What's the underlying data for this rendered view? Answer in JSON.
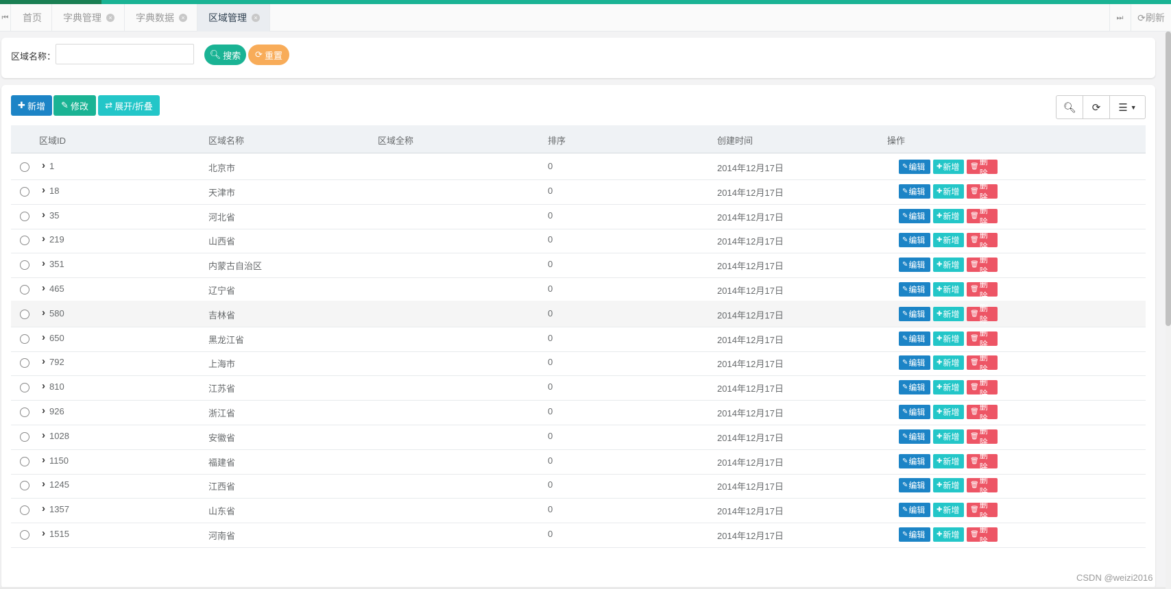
{
  "tabbar": {
    "tabs": [
      {
        "label": "首页",
        "closable": false
      },
      {
        "label": "字典管理",
        "closable": true
      },
      {
        "label": "字典数据",
        "closable": true
      },
      {
        "label": "区域管理",
        "closable": true,
        "active": true
      }
    ],
    "refresh_label": "刷新"
  },
  "search": {
    "label": "区域名称：",
    "input_value": "",
    "search_button": "搜索",
    "reset_button": "重置"
  },
  "toolbar": {
    "add_label": "新增",
    "edit_label": "修改",
    "toggle_label": "展开/折叠"
  },
  "table": {
    "columns": [
      "区域ID",
      "区域名称",
      "区域全称",
      "排序",
      "创建时间",
      "操作"
    ],
    "action_labels": {
      "edit": "编辑",
      "add": "新增",
      "delete": "删除"
    },
    "rows": [
      {
        "id": "1",
        "name": "北京市",
        "full": "",
        "sort": "0",
        "created": "2014年12月17日"
      },
      {
        "id": "18",
        "name": "天津市",
        "full": "",
        "sort": "0",
        "created": "2014年12月17日"
      },
      {
        "id": "35",
        "name": "河北省",
        "full": "",
        "sort": "0",
        "created": "2014年12月17日"
      },
      {
        "id": "219",
        "name": "山西省",
        "full": "",
        "sort": "0",
        "created": "2014年12月17日"
      },
      {
        "id": "351",
        "name": "内蒙古自治区",
        "full": "",
        "sort": "0",
        "created": "2014年12月17日"
      },
      {
        "id": "465",
        "name": "辽宁省",
        "full": "",
        "sort": "0",
        "created": "2014年12月17日"
      },
      {
        "id": "580",
        "name": "吉林省",
        "full": "",
        "sort": "0",
        "created": "2014年12月17日",
        "highlight": true
      },
      {
        "id": "650",
        "name": "黑龙江省",
        "full": "",
        "sort": "0",
        "created": "2014年12月17日"
      },
      {
        "id": "792",
        "name": "上海市",
        "full": "",
        "sort": "0",
        "created": "2014年12月17日"
      },
      {
        "id": "810",
        "name": "江苏省",
        "full": "",
        "sort": "0",
        "created": "2014年12月17日"
      },
      {
        "id": "926",
        "name": "浙江省",
        "full": "",
        "sort": "0",
        "created": "2014年12月17日"
      },
      {
        "id": "1028",
        "name": "安徽省",
        "full": "",
        "sort": "0",
        "created": "2014年12月17日"
      },
      {
        "id": "1150",
        "name": "福建省",
        "full": "",
        "sort": "0",
        "created": "2014年12月17日"
      },
      {
        "id": "1245",
        "name": "江西省",
        "full": "",
        "sort": "0",
        "created": "2014年12月17日"
      },
      {
        "id": "1357",
        "name": "山东省",
        "full": "",
        "sort": "0",
        "created": "2014年12月17日"
      },
      {
        "id": "1515",
        "name": "河南省",
        "full": "",
        "sort": "0",
        "created": "2014年12月17日"
      }
    ]
  },
  "watermark": "CSDN @weizi2016",
  "colors": {
    "primary": "#1ab394",
    "blue": "#1c84c6",
    "info": "#23c6c8",
    "danger": "#ed5565",
    "warning": "#f8ac59"
  }
}
